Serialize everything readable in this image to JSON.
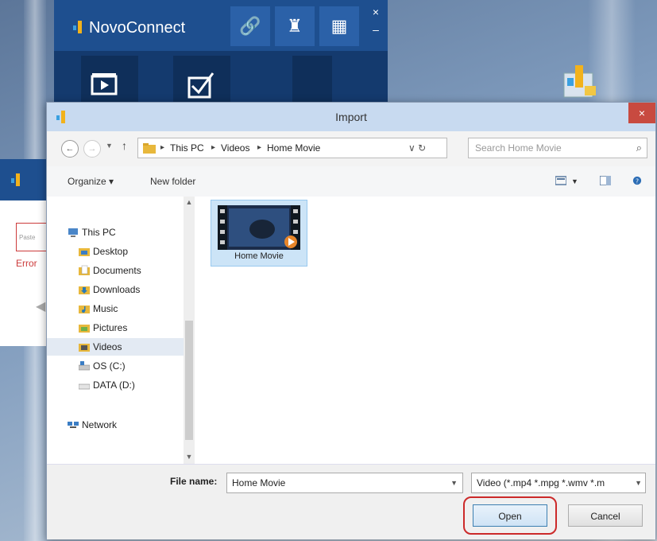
{
  "novo": {
    "title": "NovoConnect",
    "buttons": [
      {
        "name": "link-icon",
        "glyph": "🔗"
      },
      {
        "name": "users-icon",
        "glyph": "♜"
      },
      {
        "name": "grid-icon",
        "glyph": "▦"
      }
    ],
    "close_glyph": "×",
    "minimize_glyph": "–"
  },
  "background_dialog": {
    "input_placeholder": "Paste",
    "error_text": "Error"
  },
  "dialog": {
    "title": "Import",
    "close_glyph": "×",
    "nav": {
      "back": "←",
      "forward": "→",
      "up": "↑",
      "dropdown": "▼"
    },
    "breadcrumb": [
      "This PC",
      "Videos",
      "Home Movie"
    ],
    "address_controls": "∨  ↻",
    "search_placeholder": "Search Home Movie",
    "toolbar": {
      "organize": "Organize ▾",
      "new_folder": "New folder"
    },
    "nav_items": [
      {
        "label": "This PC",
        "icon": "computer-icon",
        "indent": 0
      },
      {
        "label": "Desktop",
        "icon": "desktop-folder-icon",
        "indent": 1
      },
      {
        "label": "Documents",
        "icon": "documents-folder-icon",
        "indent": 1
      },
      {
        "label": "Downloads",
        "icon": "downloads-folder-icon",
        "indent": 1
      },
      {
        "label": "Music",
        "icon": "music-folder-icon",
        "indent": 1
      },
      {
        "label": "Pictures",
        "icon": "pictures-folder-icon",
        "indent": 1
      },
      {
        "label": "Videos",
        "icon": "videos-folder-icon",
        "indent": 1,
        "selected": true
      },
      {
        "label": "OS (C:)",
        "icon": "drive-icon",
        "indent": 1
      },
      {
        "label": "DATA (D:)",
        "icon": "drive-icon",
        "indent": 1
      },
      {
        "label": "Network",
        "icon": "network-icon",
        "indent": 0
      }
    ],
    "file": {
      "name": "Home Movie",
      "icon": "video-file-icon"
    },
    "file_name_label": "File name:",
    "file_name_value": "Home Movie",
    "file_type": "Video (*.mp4 *.mpg *.wmv *.m",
    "open_label": "Open",
    "cancel_label": "Cancel"
  },
  "colors": {
    "novo_blue": "#1e4f8f",
    "titlebar": "#c8daf0",
    "close_red": "#c84a40",
    "highlight_red": "#cc2a2a",
    "selection": "#cce4f7"
  }
}
